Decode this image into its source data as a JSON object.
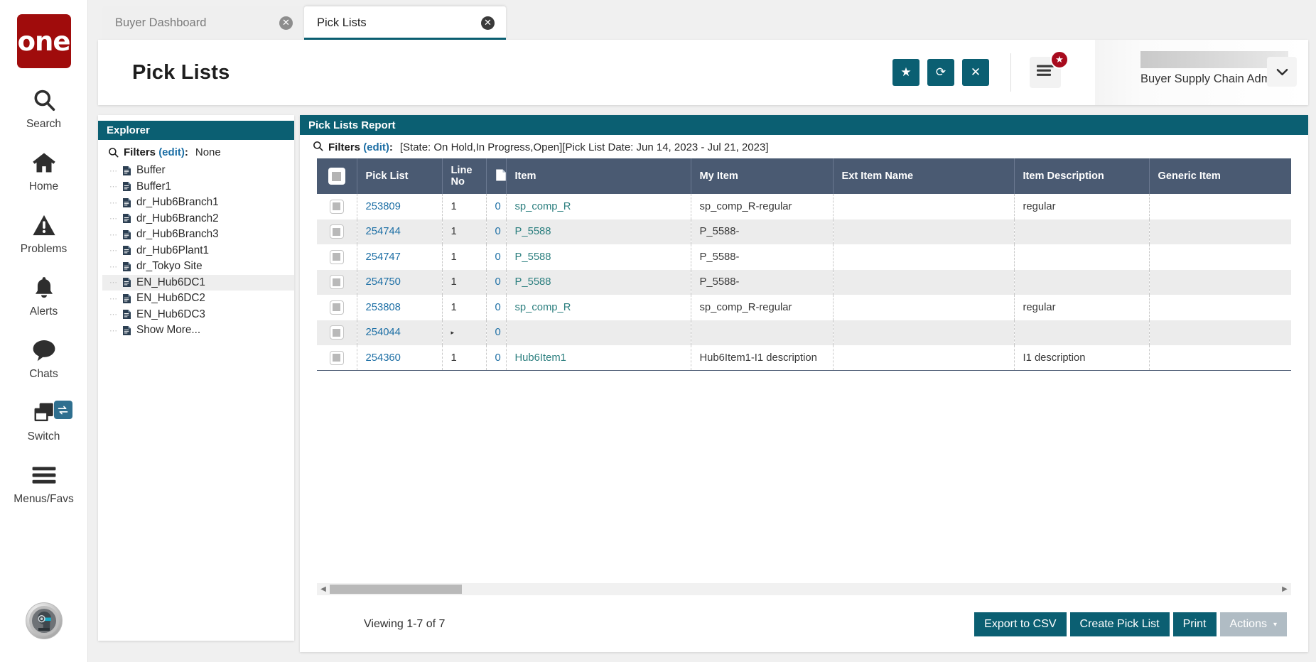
{
  "brand": {
    "logo_text": "one"
  },
  "rail": {
    "items": [
      {
        "label": "Search",
        "icon": "search-icon"
      },
      {
        "label": "Home",
        "icon": "home-icon"
      },
      {
        "label": "Problems",
        "icon": "warning-triangle-icon"
      },
      {
        "label": "Alerts",
        "icon": "bell-icon"
      },
      {
        "label": "Chats",
        "icon": "chat-bubble-icon"
      },
      {
        "label": "Switch",
        "icon": "switch-windows-icon",
        "badge_icon": "swap-arrows-icon"
      },
      {
        "label": "Menus/Favs",
        "icon": "hamburger-icon"
      }
    ],
    "avatar_icon": "robot-assistant-avatar"
  },
  "tabs": [
    {
      "label": "Buyer Dashboard",
      "active": false,
      "close_icon": "close-circle-icon"
    },
    {
      "label": "Pick Lists",
      "active": true,
      "close_icon": "close-circle-icon"
    }
  ],
  "header": {
    "title": "Pick Lists",
    "buttons": [
      {
        "name": "favorite-button",
        "icon": "star-icon",
        "glyph": "★"
      },
      {
        "name": "refresh-button",
        "icon": "refresh-icon",
        "glyph": "⟳"
      },
      {
        "name": "close-button",
        "icon": "close-x-icon",
        "glyph": "✕"
      }
    ],
    "menu_fav": {
      "icon": "hamburger-menu-icon",
      "badge_icon": "star-badge-icon",
      "badge_glyph": "★"
    },
    "user": {
      "name": "Buyer Supply Chain Admin",
      "caret_icon": "chevron-down-icon",
      "caret_glyph": "❯"
    }
  },
  "explorer": {
    "title": "Explorer",
    "filters": {
      "search_icon": "magnifier-icon",
      "label": "Filters",
      "edit_label": "(edit)",
      "colon": ":",
      "value": "None"
    },
    "items": [
      {
        "label": "Buffer",
        "icon": "document-icon",
        "selected": false
      },
      {
        "label": "Buffer1",
        "icon": "document-icon",
        "selected": false
      },
      {
        "label": "dr_Hub6Branch1",
        "icon": "document-icon",
        "selected": false
      },
      {
        "label": "dr_Hub6Branch2",
        "icon": "document-icon",
        "selected": false
      },
      {
        "label": "dr_Hub6Branch3",
        "icon": "document-icon",
        "selected": false
      },
      {
        "label": "dr_Hub6Plant1",
        "icon": "document-icon",
        "selected": false
      },
      {
        "label": "dr_Tokyo Site",
        "icon": "document-icon",
        "selected": false
      },
      {
        "label": "EN_Hub6DC1",
        "icon": "document-icon",
        "selected": true
      },
      {
        "label": "EN_Hub6DC2",
        "icon": "document-icon",
        "selected": false
      },
      {
        "label": "EN_Hub6DC3",
        "icon": "document-icon",
        "selected": false
      },
      {
        "label": "Show More...",
        "icon": "document-icon",
        "selected": false
      }
    ]
  },
  "report": {
    "title": "Pick Lists Report",
    "filters": {
      "search_icon": "magnifier-icon",
      "label": "Filters",
      "edit_label": "(edit)",
      "colon": ":",
      "value": "[State: On Hold,In Progress,Open][Pick List Date: Jun 14, 2023 - Jul 21, 2023]"
    },
    "columns": [
      {
        "key": "check",
        "label": ""
      },
      {
        "key": "pick_list",
        "label": "Pick List"
      },
      {
        "key": "line_no",
        "label": "Line No"
      },
      {
        "key": "doc",
        "label": ""
      },
      {
        "key": "item",
        "label": "Item"
      },
      {
        "key": "my_item",
        "label": "My Item"
      },
      {
        "key": "ext_item_name",
        "label": "Ext Item Name"
      },
      {
        "key": "item_description",
        "label": "Item Description"
      },
      {
        "key": "generic_item",
        "label": "Generic Item"
      }
    ],
    "rows": [
      {
        "pick_list": "253809",
        "line_no": "1",
        "doc": "0",
        "item": "sp_comp_R",
        "my_item": "sp_comp_R-regular",
        "ext_item_name": "",
        "item_description": "regular",
        "generic_item": ""
      },
      {
        "pick_list": "254744",
        "line_no": "1",
        "doc": "0",
        "item": "P_5588",
        "my_item": "P_5588-",
        "ext_item_name": "",
        "item_description": "",
        "generic_item": ""
      },
      {
        "pick_list": "254747",
        "line_no": "1",
        "doc": "0",
        "item": "P_5588",
        "my_item": "P_5588-",
        "ext_item_name": "",
        "item_description": "",
        "generic_item": ""
      },
      {
        "pick_list": "254750",
        "line_no": "1",
        "doc": "0",
        "item": "P_5588",
        "my_item": "P_5588-",
        "ext_item_name": "",
        "item_description": "",
        "generic_item": ""
      },
      {
        "pick_list": "253808",
        "line_no": "1",
        "doc": "0",
        "item": "sp_comp_R",
        "my_item": "sp_comp_R-regular",
        "ext_item_name": "",
        "item_description": "regular",
        "generic_item": ""
      },
      {
        "pick_list": "254044",
        "line_no": "▸",
        "doc": "0",
        "item": "",
        "my_item": "",
        "ext_item_name": "",
        "item_description": "",
        "generic_item": ""
      },
      {
        "pick_list": "254360",
        "line_no": "1",
        "doc": "0",
        "item": "Hub6Item1",
        "my_item": "Hub6Item1-I1 description",
        "ext_item_name": "",
        "item_description": "I1 description",
        "generic_item": ""
      }
    ],
    "header_checkbox_icon": "select-all-checkbox",
    "doc_column_icon": "document-icon",
    "scrollbar": {
      "left_arrow_icon": "scroll-left-arrow",
      "right_arrow_icon": "scroll-right-arrow"
    },
    "viewing_text": "Viewing 1-7 of 7",
    "footer_buttons": [
      {
        "name": "export-to-csv-button",
        "label": "Export to CSV",
        "disabled": false
      },
      {
        "name": "create-pick-list-button",
        "label": "Create Pick List",
        "disabled": false
      },
      {
        "name": "print-button",
        "label": "Print",
        "disabled": false
      },
      {
        "name": "actions-button",
        "label": "Actions",
        "disabled": true,
        "caret_glyph": "▾"
      }
    ]
  },
  "colors": {
    "brand_red": "#a00c0c",
    "teal": "#0b5f72",
    "table_header": "#4a5a72",
    "link_blue": "#1d6fa5",
    "link_green": "#2c7f7f",
    "disabled_gray": "#b0bcc4"
  }
}
